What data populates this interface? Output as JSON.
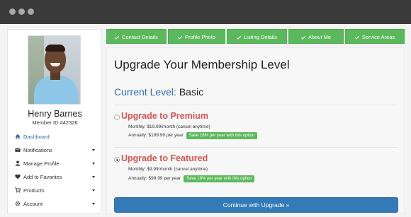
{
  "window": {
    "dots": 3
  },
  "sidebar": {
    "user_name": "Henry Barnes",
    "member_id": "Member ID #42326",
    "items": [
      {
        "label": "Dashboard",
        "icon": "home-icon",
        "active": true,
        "has_caret": false
      },
      {
        "label": "Notifications",
        "icon": "envelope-icon",
        "active": false,
        "has_caret": true
      },
      {
        "label": "Manage Profile",
        "icon": "user-icon",
        "active": false,
        "has_caret": true
      },
      {
        "label": "Add to Favorites",
        "icon": "heart-icon",
        "active": false,
        "has_caret": true
      },
      {
        "label": "Products",
        "icon": "cart-icon",
        "active": false,
        "has_caret": true
      },
      {
        "label": "Account",
        "icon": "gear-icon",
        "active": false,
        "has_caret": true
      }
    ]
  },
  "tabs": [
    {
      "label": "Contact Details"
    },
    {
      "label": "Profile Photo"
    },
    {
      "label": "Listing Details"
    },
    {
      "label": "About Me"
    },
    {
      "label": "Service Areas"
    }
  ],
  "main": {
    "title": "Upgrade Your Membership Level",
    "current_level_label": "Current Level:",
    "current_level_value": "Basic",
    "options": [
      {
        "title": "Upgrade to Premium",
        "monthly": "Monthly: $19.99/month (cancel anytime)",
        "annually": "Annually: $199.99 per year",
        "save_badge": "Save 16% per year with this option",
        "selected": false
      },
      {
        "title": "Upgrade to Featured",
        "monthly": "Monthly: $9.99/month (cancel anytime)",
        "annually": "Annually: $99.99 per year",
        "save_badge": "Save 16% per year with this option",
        "selected": true
      }
    ],
    "cta_label": "Continue with Upgrade »"
  },
  "colors": {
    "accent_blue": "#337ab7",
    "tab_green": "#5cb85c",
    "option_red": "#d9534f",
    "titlebar": "#3a3a3a"
  }
}
